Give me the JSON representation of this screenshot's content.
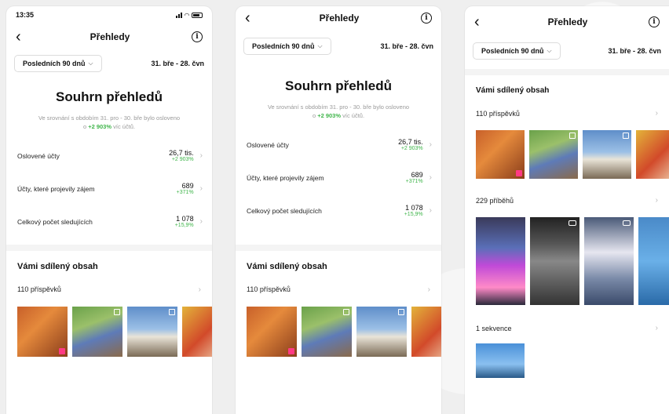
{
  "status": {
    "time": "13:35"
  },
  "nav": {
    "title": "Přehledy"
  },
  "filter": {
    "period": "Posledních 90 dnů",
    "range": "31. bře - 28. čvn"
  },
  "summary": {
    "title": "Souhrn přehledů",
    "desc_pre": "Ve srovnání s obdobím 31. pro - 30. bře bylo osloveno o",
    "desc_change": "+2 903%",
    "desc_post": "víc účtů."
  },
  "metrics": [
    {
      "label": "Oslovené účty",
      "value": "26,7 tis.",
      "change": "+2 903%"
    },
    {
      "label": "Účty, které projevily zájem",
      "value": "689",
      "change": "+371%"
    },
    {
      "label": "Celkový počet sledujících",
      "value": "1 078",
      "change": "+15,9%"
    }
  ],
  "content": {
    "title": "Vámi sdílený obsah",
    "posts": "110 příspěvků",
    "stories": "229 příběhů",
    "reels": "1 sekvence"
  },
  "colors": {
    "accent_green": "#3fb54a",
    "story_pink": "#ff3a84"
  }
}
